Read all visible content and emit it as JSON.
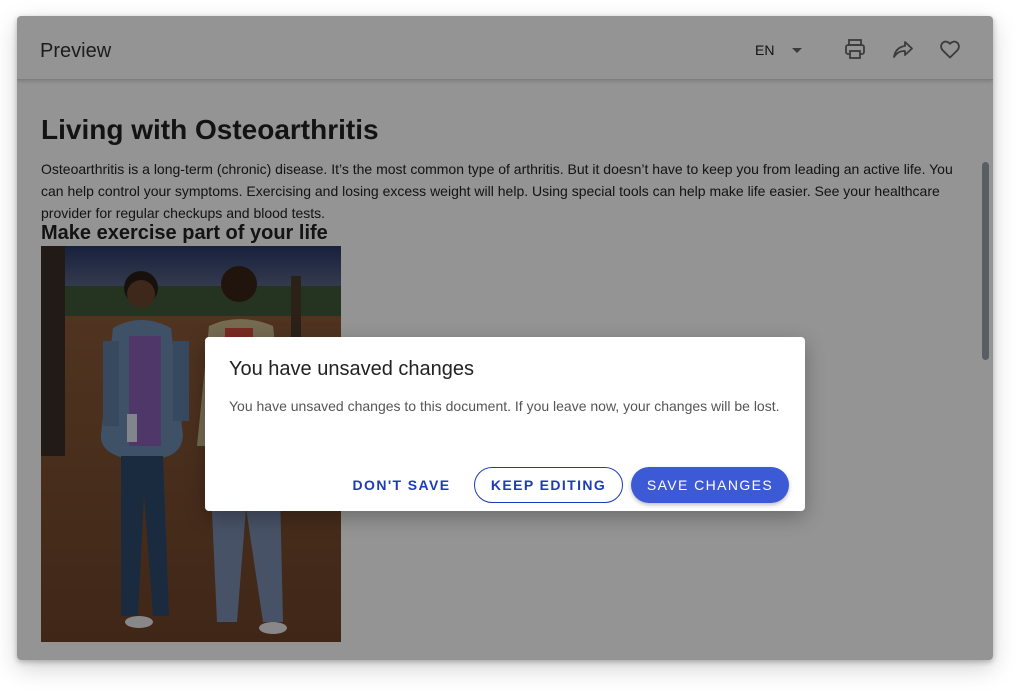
{
  "header": {
    "title": "Preview",
    "language": "EN",
    "icons": [
      "printer-icon",
      "share-icon",
      "heart-icon"
    ]
  },
  "document": {
    "title": "Living with Osteoarthritis",
    "paragraph": "Osteoarthritis is a long-term (chronic) disease. It’s the most common type of arthritis. But it doesn’t have to keep you from leading an active life. You can help control your symptoms. Exercising and losing excess weight will help. Using special tools can help make life easier. See your healthcare provider for regular checkups and blood tests.",
    "subheading": "Make exercise part of your life"
  },
  "dialog": {
    "title": "You have unsaved changes",
    "message": "You have unsaved changes to this document. If you leave now, your changes will be lost.",
    "dont_save": "Don't save",
    "keep_editing": "Keep editing",
    "save_changes": "Save changes"
  },
  "colors": {
    "primary": "#3d5ad6",
    "primary_text": "#1c3bb8",
    "overlay": "rgba(0,0,0,0.42)"
  }
}
